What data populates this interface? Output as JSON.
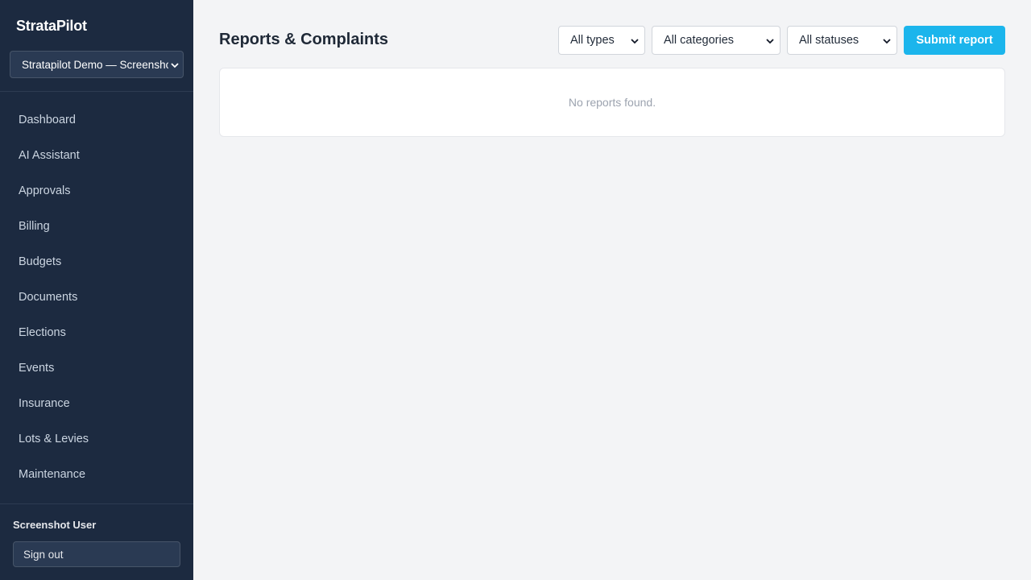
{
  "app": {
    "brand": "StrataPilot"
  },
  "sidebar": {
    "org_selector": {
      "value": "Stratapilot Demo — Screenshot"
    },
    "items": [
      {
        "label": "Dashboard"
      },
      {
        "label": "AI Assistant"
      },
      {
        "label": "Approvals"
      },
      {
        "label": "Billing"
      },
      {
        "label": "Budgets"
      },
      {
        "label": "Documents"
      },
      {
        "label": "Elections"
      },
      {
        "label": "Events"
      },
      {
        "label": "Insurance"
      },
      {
        "label": "Lots & Levies"
      },
      {
        "label": "Maintenance"
      }
    ],
    "user": {
      "name": "Screenshot User"
    },
    "sign_out_label": "Sign out"
  },
  "main": {
    "title": "Reports & Complaints",
    "filters": {
      "type": "All types",
      "category": "All categories",
      "status": "All statuses"
    },
    "submit_label": "Submit report",
    "empty_message": "No reports found."
  },
  "colors": {
    "sidebar_bg": "#1c2a40",
    "accent": "#1bb5ec",
    "page_bg": "#f3f4f6"
  },
  "icons": {
    "select_arrow": "chevron-down-icon"
  }
}
